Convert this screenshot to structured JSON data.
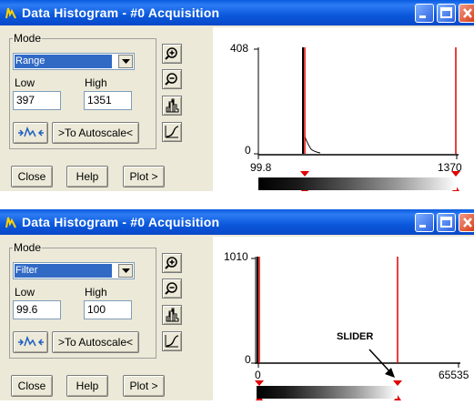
{
  "windows": [
    {
      "title": "Data Histogram - #0  Acquisition",
      "mode_label": "Mode",
      "mode_value": "Range",
      "low_label": "Low",
      "high_label": "High",
      "low_value": "397",
      "high_value": "1351",
      "autoscale_label": ">To Autoscale<",
      "close_label": "Close",
      "help_label": "Help",
      "plot_label": "Plot >",
      "y_max_label": "408",
      "y_min_label": "0",
      "x_min_label": "99.8",
      "x_max_label": "1370",
      "slider_annotation": ""
    },
    {
      "title": "Data Histogram - #0  Acquisition",
      "mode_label": "Mode",
      "mode_value": "Filter",
      "low_label": "Low",
      "high_label": "High",
      "low_value": "99.6",
      "high_value": "100",
      "autoscale_label": ">To Autoscale<",
      "close_label": "Close",
      "help_label": "Help",
      "plot_label": "Plot >",
      "y_max_label": "1010",
      "y_min_label": "0",
      "x_min_label": "0",
      "x_max_label": "65535",
      "slider_annotation": "SLIDER"
    }
  ],
  "icons": [
    "histogram-app-icon",
    "minimize-icon",
    "maximize-icon",
    "close-icon",
    "zoom-in-icon",
    "zoom-out-icon",
    "histogram-icon",
    "curve-icon",
    "auto-range-icon",
    "dropdown-arrow-icon"
  ],
  "colors": {
    "titlebar": "#0a5be0",
    "selection": "#316ac5",
    "marker": "#e00000",
    "window": "#ece9d8"
  }
}
